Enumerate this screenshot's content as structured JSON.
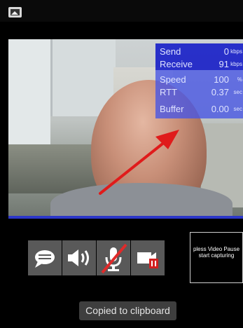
{
  "stats": {
    "send_label": "Send",
    "send_value": "0",
    "send_unit": "kbps",
    "receive_label": "Receive",
    "receive_value": "91",
    "receive_unit": "kbps",
    "speed_label": "Speed",
    "speed_value": "100",
    "speed_unit": "%",
    "rtt_label": "RTT",
    "rtt_value": "0.37",
    "rtt_unit": "sec",
    "buffer_label": "Buffer",
    "buffer_value": "0.00",
    "buffer_unit": "sec"
  },
  "controls": {
    "chat_icon": "chat-bubble-icon",
    "speaker_icon": "speaker-icon",
    "mic_icon": "microphone-muted-icon",
    "camera_icon": "video-camera-paused-icon"
  },
  "preview": {
    "line1": "pless Video Pause",
    "line2": "start capturing"
  },
  "toast": {
    "text": "Copied to clipboard"
  },
  "colors": {
    "stats_top": "#1a22c8",
    "stats_bottom": "#4655e6",
    "arrow": "#e01b1b",
    "mute_slash": "#e02a2a",
    "pause_badge": "#d22020"
  }
}
